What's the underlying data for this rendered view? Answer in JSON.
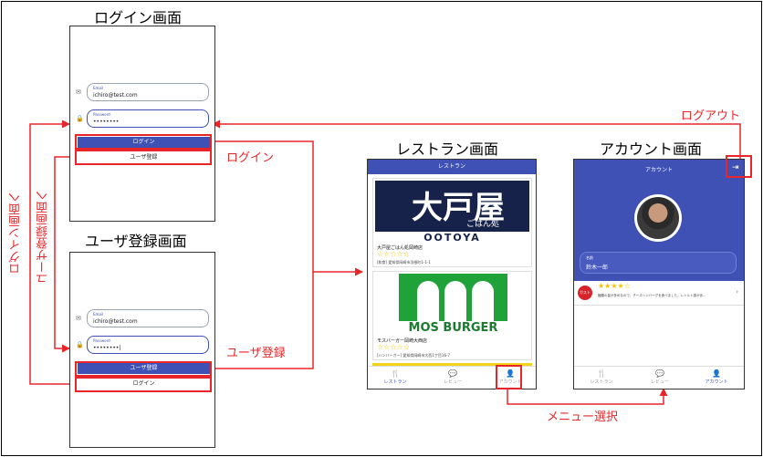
{
  "titles": {
    "login": "ログイン画面",
    "register": "ユーザ登録画面",
    "restaurant": "レストラン画面",
    "account": "アカウント画面"
  },
  "login_screen": {
    "email_label": "Email",
    "email_value": "ichiro@test.com",
    "password_label": "Password",
    "password_value": "••••••••",
    "primary_button": "ログイン",
    "secondary_button": "ユーザ登録"
  },
  "register_screen": {
    "email_label": "Email",
    "email_value": "ichiro@test.com",
    "password_label": "Password",
    "password_value": "••••••••|",
    "primary_button": "ユーザ登録",
    "secondary_button": "ログイン"
  },
  "restaurant_screen": {
    "appbar_title": "レストラン",
    "cards": [
      {
        "brand_text_main": "大戸屋",
        "brand_text_sub": "ごはん処",
        "brand_text_band": "OOTOYA",
        "name": "大戸屋ごはん処岡崎店",
        "stars": "☆☆☆☆☆",
        "detail": "[和食] 愛知県岡崎市羽根町1-1-1"
      },
      {
        "brand_text_band": "MOS BURGER",
        "name": "モスバーガー岡崎大西店",
        "stars": "☆☆☆☆☆",
        "detail": "[ハンバーガー] 愛知県岡崎市大西1丁目16-7"
      }
    ],
    "nav": [
      "レストラン",
      "レビュー",
      "アカウント"
    ]
  },
  "account_screen": {
    "appbar_title": "アカウント",
    "name_label": "名前",
    "name_value": "鈴木一郎",
    "review": {
      "logo_text": "ガスト",
      "stars": "★★★★☆",
      "text": "麺類の量が多めなので、チーズハンバーグを食べました。レトルト感があ..."
    },
    "nav": [
      "レストラン",
      "レビュー",
      "アカウント"
    ]
  },
  "arrows": {
    "login": "ログイン",
    "register": "ユーザ登録",
    "logout": "ログアウト",
    "menu_select": "メニュー選択",
    "to_login": "ログイン画面へ",
    "to_register": "ユーザ登録画面へ"
  },
  "colors": {
    "primary": "#3f51b5",
    "annotation": "#e8262a",
    "star": "#f2c200"
  }
}
